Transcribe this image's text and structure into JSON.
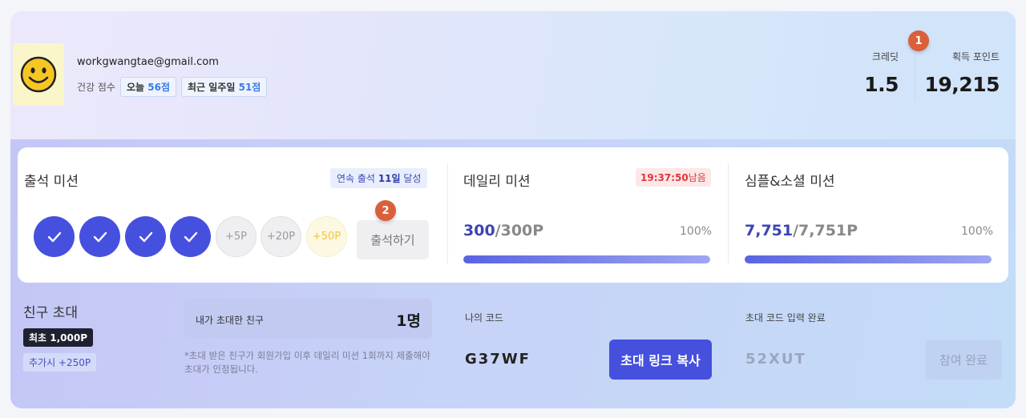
{
  "profile": {
    "email": "workgwangtae@gmail.com",
    "health_label": "건강 점수",
    "today_label": "오늘",
    "today_score": "56점",
    "week_label": "최근 일주일",
    "week_score": "51점",
    "avatar_icon": "smiley-face-icon"
  },
  "stats": {
    "credit_label": "크레딧",
    "credit_value": "1.5",
    "points_label": "획득 포인트",
    "points_value": "19,215"
  },
  "badges": [
    "1",
    "2"
  ],
  "attendance": {
    "title": "출석 미션",
    "streak_prefix": "연속 출석",
    "streak_days": "11일",
    "streak_suffix": "달성",
    "rewards": [
      "+5P",
      "+20P",
      "+50P"
    ],
    "completed_count": 4,
    "button_label": "출석하기"
  },
  "daily": {
    "title": "데일리 미션",
    "timer": "19:37:50",
    "timer_unit": "남음",
    "current": "300",
    "total": "/300P",
    "percent_label": "100%",
    "progress": 1.0
  },
  "social": {
    "title": "심플&소셜 미션",
    "current": "7,751",
    "total": "/7,751P",
    "percent_label": "100%",
    "progress": 1.0
  },
  "invite": {
    "title": "친구 초대",
    "first_reward": "최초 1,000P",
    "extra_reward": "추가시 +250P",
    "invited_label": "내가 초대한 친구",
    "invited_count": "1명",
    "note": "*초대 받은 친구가 회원가입 이후 데일리 미션 1회까지 제출해야 초대가 인정됩니다.",
    "my_code_label": "나의 코드",
    "my_code": "G37WF",
    "copy_button": "초대 링크 복사",
    "entered_label": "초대 코드 입력 완료",
    "entered_code": "52XUT",
    "join_button": "참여 완료"
  },
  "colors": {
    "accent": "#4650df",
    "badge": "#d9603b",
    "timer_red": "#e0373a"
  }
}
